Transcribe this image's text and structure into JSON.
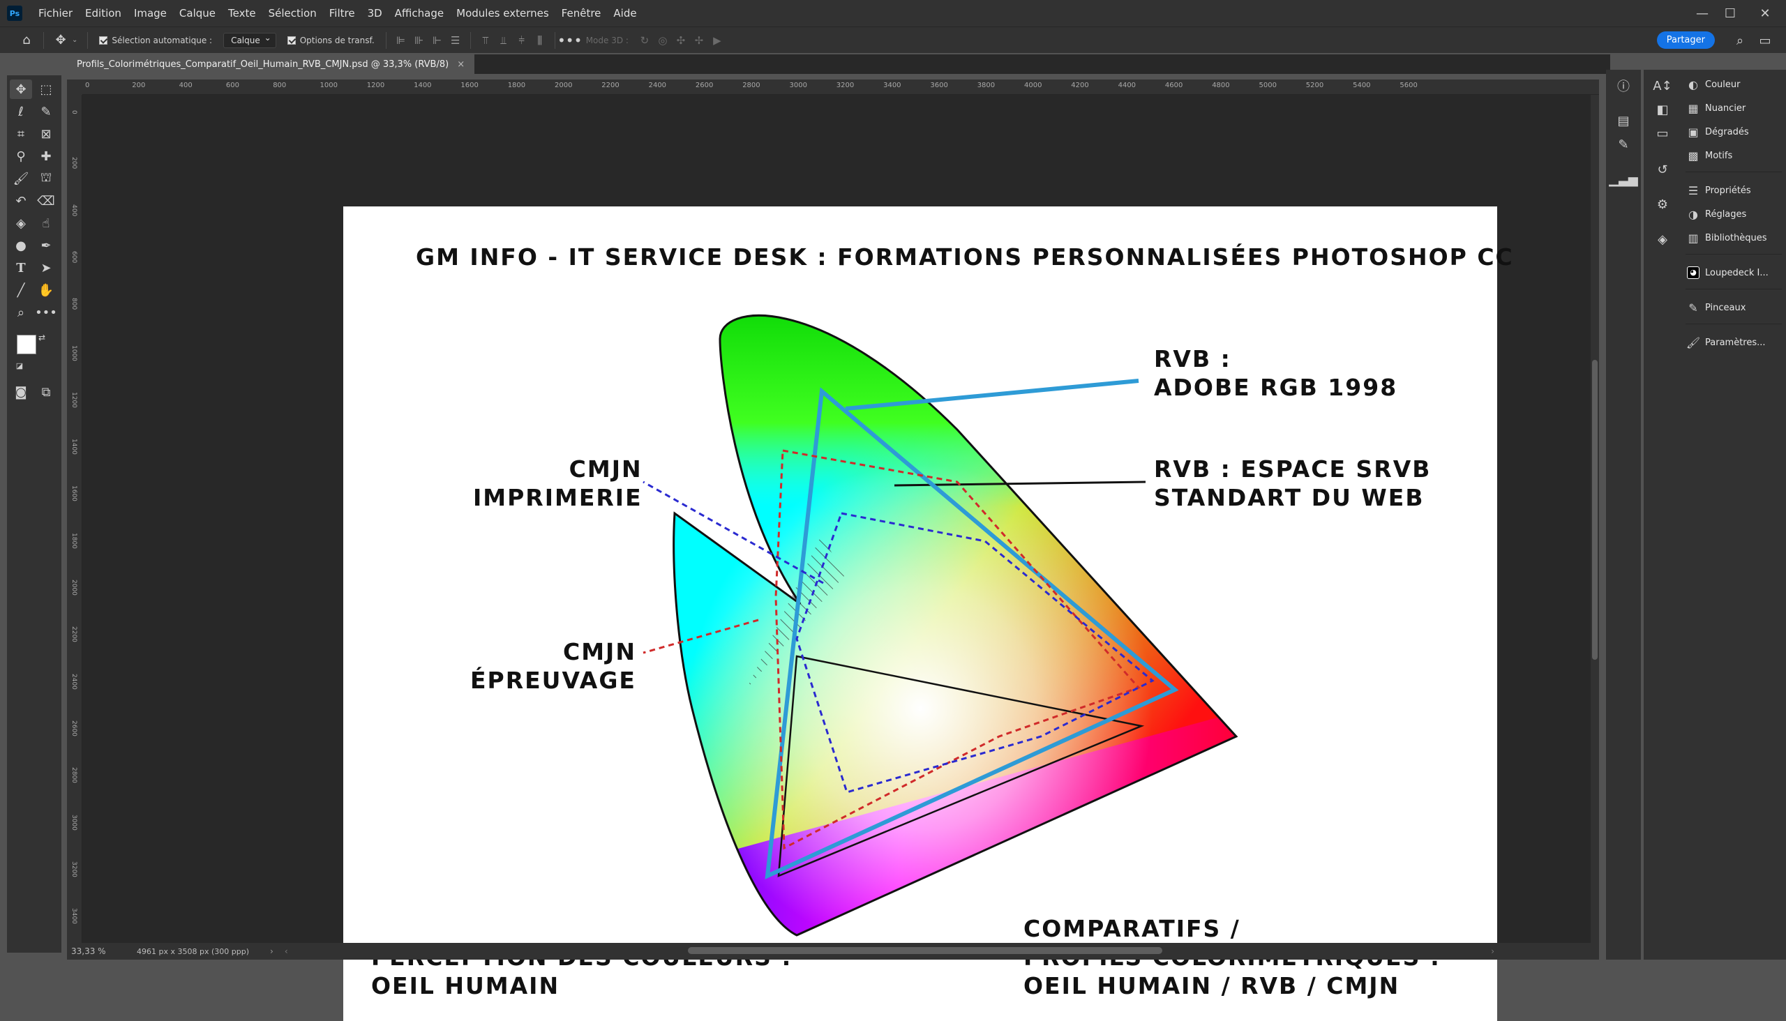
{
  "app": {
    "name": "Photoshop",
    "logo_text": "Ps"
  },
  "menu": [
    "Fichier",
    "Edition",
    "Image",
    "Calque",
    "Texte",
    "Sélection",
    "Filtre",
    "3D",
    "Affichage",
    "Modules externes",
    "Fenêtre",
    "Aide"
  ],
  "options_bar": {
    "auto_select_label": "Sélection automatique :",
    "auto_select_value": "Calque",
    "transform_label": "Options de transf.",
    "mode3d_label": "Mode 3D :",
    "share_label": "Partager"
  },
  "document_tab": {
    "title": "Profils_Colorimétriques_Comparatif_Oeil_Humain_RVB_CMJN.psd @ 33,3% (RVB/8)",
    "close": "×"
  },
  "ruler_top_labels": [
    "0",
    "200",
    "400",
    "600",
    "800",
    "1000",
    "1200",
    "1400",
    "1600",
    "1800",
    "2000",
    "2200",
    "2400",
    "2600",
    "2800",
    "3000",
    "3200",
    "3400",
    "3600",
    "3800",
    "4000",
    "4200",
    "4400",
    "4600",
    "4800",
    "5000",
    "5200",
    "5400",
    "5600"
  ],
  "ruler_left_labels": [
    "0",
    "2 0 0",
    "4 0 0",
    "6 0 0",
    "8 0 0",
    "1 0 0 0",
    "1 2 0 0",
    "1 4 0 0",
    "1 6 0 0",
    "1 8 0 0",
    "2 0 0 0",
    "2 2 0 0",
    "2 4 0 0",
    "2 6 0 0",
    "2 8 0 0",
    "3 0 0 0",
    "3 2 0 0",
    "3 4 0 0"
  ],
  "image_content": {
    "title": "GM INFO - IT SERVICE DESK : FORMATIONS PERSONNALISÉES PHOTOSHOP CC",
    "rvb_adobe": "RVB :\nADOBE RGB 1998",
    "rvb_srvb": "RVB : ESPACE SRVB\nSTANDART DU WEB",
    "cmjn_imprimerie": "CMJN\nIMPRIMERIE",
    "cmjn_epreuvage": "CMJN\nÉPREUVAGE",
    "perception": "PERCEPTION DES COULEURS :\nOEIL HUMAIN",
    "comparatifs": "COMPARATIFS /\nPROFILS COLORIMÉTRIQUES :\nOEIL HUMAIN / RVB / CMJN",
    "colors": {
      "adobe_line": "#2e9bd6",
      "srvb_line": "#222222",
      "imprimerie_line": "#2a2ad0",
      "epreuvage_line": "#d02a2a"
    }
  },
  "status_bar": {
    "zoom": "33,33 %",
    "doc_info": "4961 px x 3508 px (300 ppp)"
  },
  "panels": [
    {
      "label": "Couleur",
      "icon": "color-wheel-icon"
    },
    {
      "label": "Nuancier",
      "icon": "swatches-icon"
    },
    {
      "label": "Dégradés",
      "icon": "gradient-icon"
    },
    {
      "label": "Motifs",
      "icon": "patterns-icon"
    },
    {
      "label": "Propriétés",
      "icon": "properties-icon"
    },
    {
      "label": "Réglages",
      "icon": "adjustments-icon"
    },
    {
      "label": "Bibliothèques",
      "icon": "libraries-icon"
    },
    {
      "label": "Loupedeck I...",
      "icon": "loupedeck-icon"
    },
    {
      "label": "Pinceaux",
      "icon": "brushes-icon"
    },
    {
      "label": "Paramètres...",
      "icon": "brush-settings-icon"
    }
  ]
}
